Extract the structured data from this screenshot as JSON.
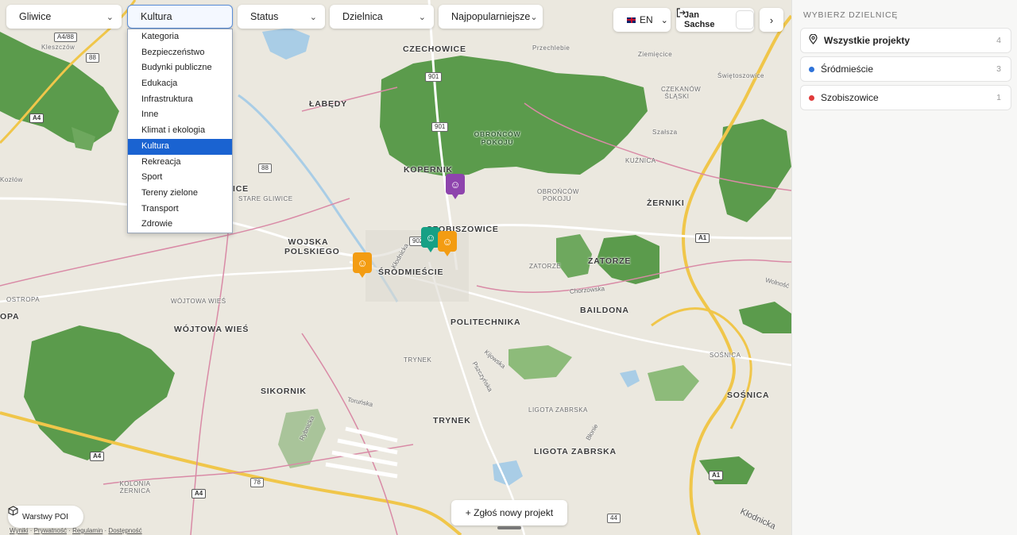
{
  "filters": {
    "city": "Gliwice",
    "category": "Kultura",
    "status": "Status",
    "district": "Dzielnica",
    "sort": "Najpopularniejsze"
  },
  "category_options": [
    "Kategoria",
    "Bezpieczeństwo",
    "Budynki publiczne",
    "Edukacja",
    "Infrastruktura",
    "Inne",
    "Klimat i ekologia",
    "Kultura",
    "Rekreacja",
    "Sport",
    "Tereny zielone",
    "Transport",
    "Zdrowie"
  ],
  "selected_category_index": 7,
  "header": {
    "language": "EN",
    "user_name": "Jan Sachse"
  },
  "panel": {
    "title": "WYBIERZ DZIELNICĘ",
    "districts": [
      {
        "name": "Wszystkie projekty",
        "count": "4",
        "marker": "map-pin-icon"
      },
      {
        "name": "Śródmieście",
        "count": "3",
        "color": "#2f73d9"
      },
      {
        "name": "Szobiszowice",
        "count": "1",
        "color": "#e03a3a"
      }
    ]
  },
  "actions": {
    "report_project": "+ Zgłoś nowy projekt",
    "poi_layers": "Warstwy POI"
  },
  "footer": {
    "links": [
      "Wyniki",
      "Prywatność",
      "Regulamin",
      "Dostępność"
    ],
    "separator": " · "
  },
  "map": {
    "places": [
      "CZECHOWICE",
      "ŁABĘDY",
      "OBROŃCÓW POKOJU",
      "KOPERNIK",
      "SZOBISZOWICE",
      "ŻERNIKI",
      "WOJSKA POLSKIEGO",
      "ŚRÓDMIEŚCIE",
      "ZATORZE",
      "BAILDONA",
      "POLITECHNIKA",
      "WÓJTOWA WIEŚ",
      "SIKORNIK",
      "TRYNEK",
      "LIGOTA ZABRSKA",
      "SOŚNICA"
    ],
    "small_places": [
      "Kleszczów",
      "Przechlebie",
      "Ziemięcice",
      "Świętoszowice",
      "CZEKANÓW ŚLĄSKI",
      "Szałsza",
      "KUŹNICA",
      "OBROŃCÓW POKOJU",
      "ZATORZE",
      "TRYNEK",
      "LIGOTA ZABRSKA",
      "SOŚNICA",
      "OSTROPA",
      "OPA",
      "STARE GLIWICE",
      "Kozłów",
      "WÓJTOWA WIEŚ",
      "KOLONIA ŻERNICA",
      "ICE"
    ],
    "roads": [
      "A4",
      "88",
      "901",
      "902",
      "A1",
      "78",
      "44",
      "A4/88"
    ],
    "streets": [
      "Toruńska",
      "Kłodnicka",
      "Kijowska",
      "Pszczyńska",
      "Chorzowska",
      "Wolność",
      "Rybnicka",
      "Błonie",
      "Zatorze",
      "Trynek",
      "Hatorze"
    ],
    "markers": [
      {
        "color": "#8e44ad",
        "icon": "smile-icon"
      },
      {
        "color": "#16a085",
        "icon": "smile-icon"
      },
      {
        "color": "#f39c12",
        "icon": "smile-icon"
      },
      {
        "color": "#f39c12",
        "icon": "smile-icon"
      }
    ]
  }
}
